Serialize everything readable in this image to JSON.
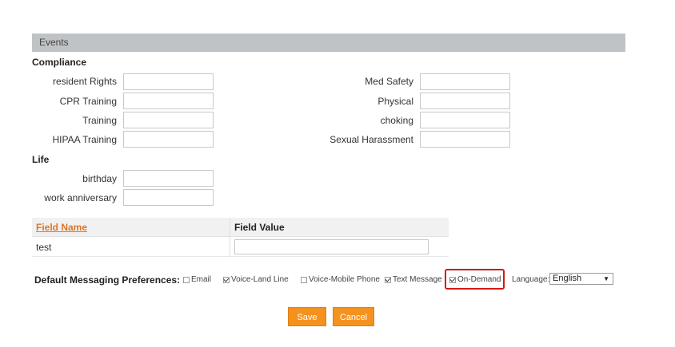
{
  "section": {
    "title": "Events"
  },
  "compliance": {
    "title": "Compliance",
    "left_fields": [
      {
        "label": "resident Rights",
        "value": ""
      },
      {
        "label": "CPR Training",
        "value": ""
      },
      {
        "label": "Training",
        "value": ""
      },
      {
        "label": "HIPAA Training",
        "value": ""
      }
    ],
    "right_fields": [
      {
        "label": "Med Safety",
        "value": ""
      },
      {
        "label": "Physical",
        "value": ""
      },
      {
        "label": "choking",
        "value": ""
      },
      {
        "label": "Sexual Harassment",
        "value": ""
      }
    ]
  },
  "life": {
    "title": "Life",
    "fields": [
      {
        "label": "birthday",
        "value": ""
      },
      {
        "label": "work anniversary",
        "value": ""
      }
    ]
  },
  "custom_fields": {
    "columns": [
      "Field Name",
      "Field Value"
    ],
    "rows": [
      {
        "name": "test",
        "value": ""
      }
    ]
  },
  "messaging": {
    "label": "Default Messaging Preferences:",
    "options": [
      {
        "label": "Email",
        "checked": false
      },
      {
        "label": "Voice-Land Line",
        "checked": true
      },
      {
        "label": "Voice-Mobile Phone",
        "checked": false
      },
      {
        "label": "Text Message",
        "checked": true
      },
      {
        "label": "On-Demand",
        "checked": true
      }
    ],
    "language_label": "Language:",
    "language_value": "English"
  },
  "buttons": {
    "save": "Save",
    "cancel": "Cancel"
  },
  "colors": {
    "accent": "#f5921e",
    "highlight": "#d31919",
    "link": "#e27424",
    "section_bar": "#bfc3c6"
  }
}
